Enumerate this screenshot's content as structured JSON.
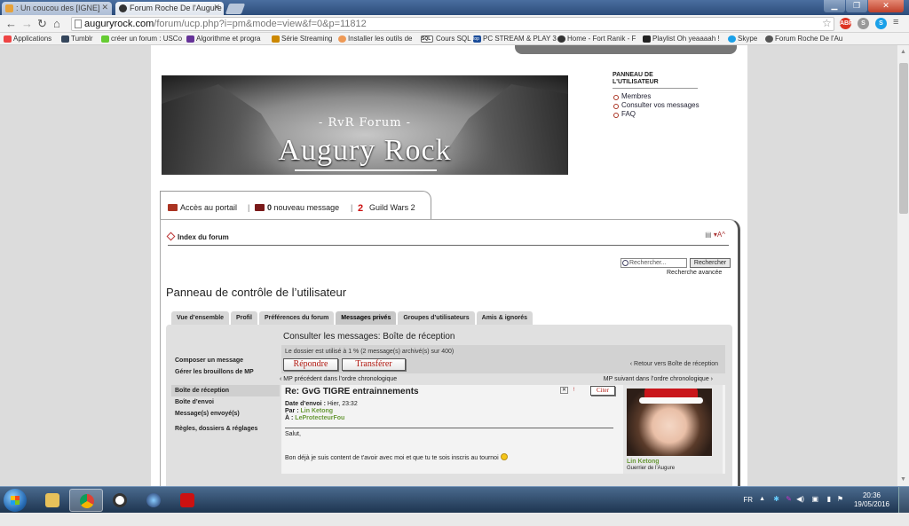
{
  "browser": {
    "tabs": [
      {
        "title": ": Un coucou des [IGNE]",
        "active": false
      },
      {
        "title": "Forum Roche De l'Augure",
        "active": true
      }
    ],
    "url_domain": "auguryrock.com",
    "url_path": "/forum/ucp.php?i=pm&mode=view&f=0&p=11812",
    "bookmarks": [
      "Applications",
      "Tumblr",
      "créer un forum : USCo",
      "Algorithme et progra",
      "Série Streaming",
      "Installer les outils de",
      "Cours SQL",
      "PC STREAM & PLAY 3",
      "Home - Fort Ranik - F",
      "Playlist Oh yeaaaah !",
      "Skype",
      "Forum Roche De l'Au"
    ],
    "bookmark_badge": "SQL",
    "bookmark_badge2": "top"
  },
  "site": {
    "banner_sub": "- RvR Forum -",
    "banner_title": "Augury Rock",
    "user_panel_title": "PANNEAU DE L'UTILISATEUR",
    "user_panel_links": [
      "Membres",
      "Consulter vos messages",
      "FAQ"
    ],
    "portal_link": "Accès au portail",
    "new_msg_count": "0",
    "new_msg_label": "nouveau message",
    "gw2_link": "Guild Wars 2",
    "breadcrumb": "Index du forum",
    "search_placeholder": "Rechercher...",
    "search_button": "Rechercher",
    "advanced_search": "Recherche avancée"
  },
  "ucp": {
    "title": "Panneau de contrôle de l’utilisateur",
    "tabs": [
      "Vue d’ensemble",
      "Profil",
      "Préférences du forum",
      "Messages privés",
      "Groupes d’utilisateurs",
      "Amis & ignorés"
    ],
    "active_tab": 3,
    "sidebar": [
      "Composer un message",
      "Gérer les brouillons de MP",
      "Boîte de réception",
      "Boîte d’envoi",
      "Message(s) envoyé(s)",
      "Règles, dossiers & réglages"
    ],
    "selected_sidebar": 2,
    "heading": "Consulter les messages: Boîte de réception",
    "folder_info": "Le dossier est utilisé à 1 % (2 message(s) archivé(s) sur 400)",
    "reply_button": "Répondre",
    "forward_button": "Transférer",
    "back_link": "‹ Retour vers Boîte de réception",
    "prev_link": "‹ MP précédent dans l’ordre chronologique",
    "next_link": "MP suivant dans l’ordre chronologique ›"
  },
  "message": {
    "subject": "Re: GvG TIGRE entrainnements",
    "date_label": "Date d’envoi :",
    "date_value": "Hier, 23:32",
    "from_label": "Par :",
    "from_value": "Lin Ketong",
    "to_label": "À :",
    "to_value": "LeProtecteurFou",
    "quote_button": "Citer",
    "body_line1": "Salut,",
    "body_line2": "Bon déjà je suis content de t'avoir avec moi et que tu te sois inscris au tournoi",
    "author_name": "Lin Ketong",
    "author_rank": "Guerrier de l’Augure"
  },
  "taskbar": {
    "lang": "FR",
    "time": "20:36",
    "date": "19/05/2016"
  },
  "colors": {
    "accent_red": "#b1180f",
    "username_green": "#6a9a3a",
    "taskbar": "#1e3550"
  }
}
